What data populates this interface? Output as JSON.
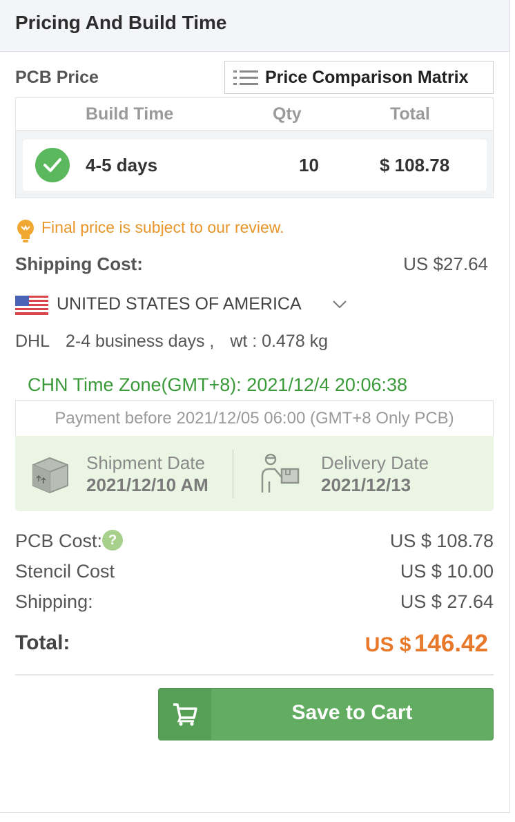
{
  "panel": {
    "title": "Pricing And Build Time"
  },
  "pcb_price": {
    "label": "PCB Price",
    "matrix_button": "Price Comparison Matrix",
    "columns": [
      "Build Time",
      "Qty",
      "Total"
    ],
    "row": {
      "build_time": "4-5 days",
      "qty": "10",
      "total": "$ 108.78",
      "selected": true
    }
  },
  "notice": "Final price is subject to our review.",
  "shipping": {
    "label": "Shipping Cost:",
    "value": "US $27.64",
    "country": "UNITED STATES OF AMERICA",
    "carrier": "DHL",
    "days": "2-4 business days ,",
    "weight": "wt : 0.478 kg"
  },
  "schedule": {
    "timezone": "CHN Time Zone(GMT+8): 2021/12/4 20:06:38",
    "payment": "Payment before 2021/12/05 06:00 (GMT+8 Only PCB)",
    "shipment_label": "Shipment Date",
    "shipment_date": "2021/12/10 AM",
    "delivery_label": "Delivery Date",
    "delivery_date": "2021/12/13"
  },
  "costs": {
    "pcb_label": "PCB Cost:",
    "pcb_value": "US $ 108.78",
    "help_glyph": "?",
    "stencil_label": "Stencil Cost",
    "stencil_value": "US $ 10.00",
    "shipping_label": "Shipping:",
    "shipping_value": "US $ 27.64",
    "total_label": "Total:",
    "total_currency": "US $",
    "total_amount": "146.42"
  },
  "cart": {
    "label": "Save to Cart"
  },
  "colors": {
    "accent_green": "#63ad62",
    "total_orange": "#e8782a",
    "notice_orange": "#e8962b",
    "timezone_green": "#3a9a3a"
  }
}
